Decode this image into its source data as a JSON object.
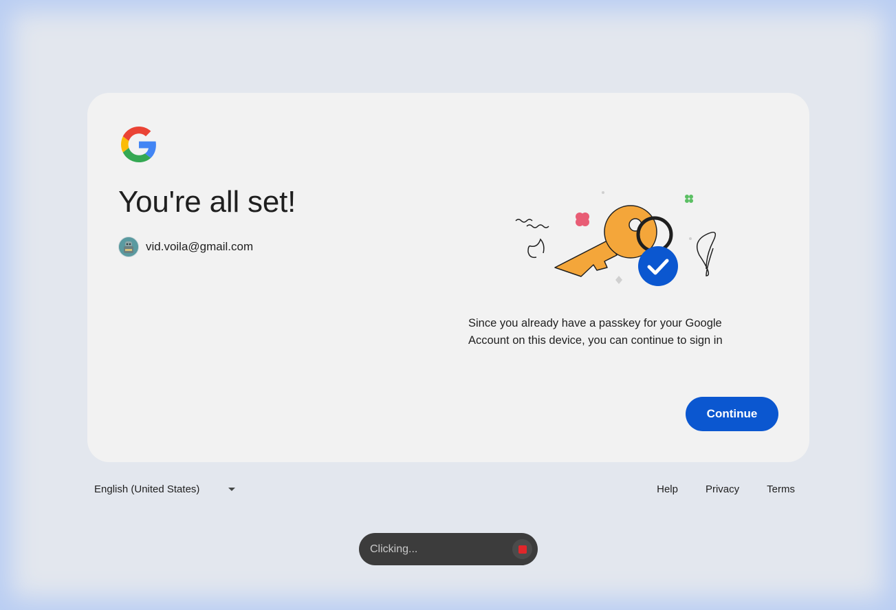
{
  "card": {
    "title": "You're all set!",
    "account_email": "vid.voila@gmail.com",
    "passkey_message": "Since you already have a passkey for your Google Account on this device, you can continue to sign in",
    "continue_label": "Continue"
  },
  "footer": {
    "language": "English (United States)",
    "links": {
      "help": "Help",
      "privacy": "Privacy",
      "terms": "Terms"
    }
  },
  "status_overlay": {
    "text": "Clicking..."
  },
  "icons": {
    "logo": "google-g-logo",
    "language_caret": "caret-down-icon",
    "stop": "stop-icon",
    "illustration": "passkey-key-illustration"
  },
  "colors": {
    "background": "#e3e7ee",
    "card": "#f2f2f2",
    "primary_button": "#0b57d0",
    "key": "#f4a63a",
    "check_badge": "#0b57d0",
    "stop": "#e0262a"
  }
}
